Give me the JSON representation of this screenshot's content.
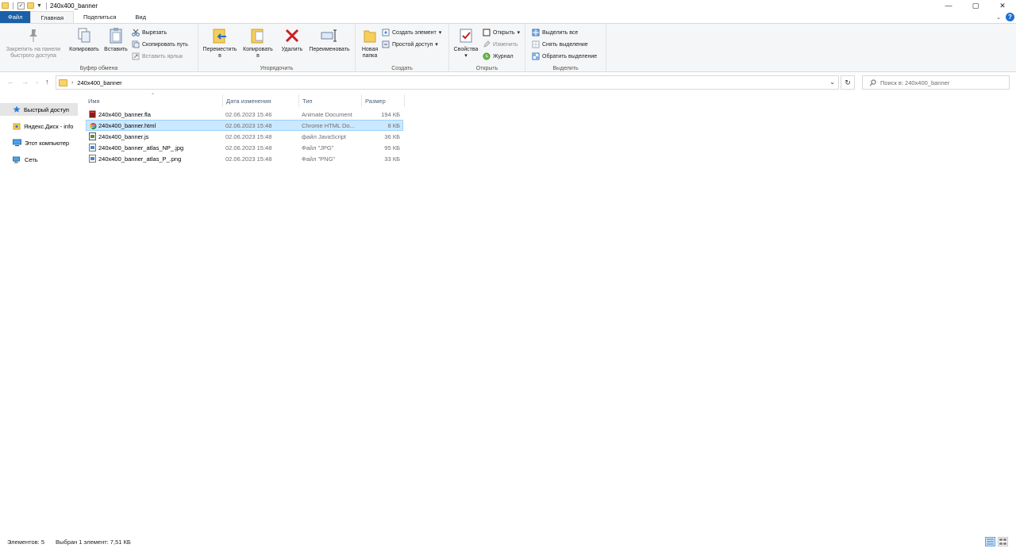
{
  "window": {
    "title": "240x400_banner",
    "controls": {
      "minimize": "—",
      "maximize": "▢",
      "close": "✕"
    }
  },
  "ribbon_tabs": [
    {
      "label": "Файл"
    },
    {
      "label": "Главная"
    },
    {
      "label": "Поделиться"
    },
    {
      "label": "Вид"
    }
  ],
  "ribbon": {
    "clipboard": {
      "label": "Буфер обмена",
      "pin_line1": "Закрепить на панели",
      "pin_line2": "быстрого доступа",
      "copy": "Копировать",
      "paste": "Вставить",
      "cut": "Вырезать",
      "copy_path": "Скопировать путь",
      "paste_shortcut": "Вставить ярлык"
    },
    "organize": {
      "label": "Упорядочить",
      "move_line1": "Переместить",
      "move_line2": "в",
      "copy_line1": "Копировать",
      "copy_line2": "в",
      "delete": "Удалить",
      "rename": "Переименовать"
    },
    "create": {
      "label": "Создать",
      "new_folder_line1": "Новая",
      "new_folder_line2": "папка",
      "new_item": "Создать элемент",
      "easy_access": "Простой доступ"
    },
    "open": {
      "label": "Открыть",
      "properties": "Свойства",
      "open": "Открыть",
      "edit": "Изменить",
      "history": "Журнал"
    },
    "select": {
      "label": "Выделить",
      "select_all": "Выделить все",
      "select_none": "Снять выделение",
      "invert": "Обратить выделение"
    }
  },
  "address": {
    "path": "240x400_banner",
    "search_placeholder": "Поиск в: 240x400_banner"
  },
  "nav_pane": [
    {
      "label": "Быстрый доступ",
      "icon": "star-icon",
      "selected": true
    },
    {
      "label": "Яндекс.Диск - info",
      "icon": "yandex-disk-icon",
      "selected": false
    },
    {
      "label": "Этот компьютер",
      "icon": "computer-icon",
      "selected": false
    },
    {
      "label": "Сеть",
      "icon": "network-icon",
      "selected": false
    }
  ],
  "columns": {
    "name": "Имя",
    "date": "Дата изменения",
    "type": "Тип",
    "size": "Размер"
  },
  "files": [
    {
      "name": "240x400_banner.fla",
      "date": "02.06.2023 15:46",
      "type": "Animate Document",
      "size": "194 КБ",
      "icon": "fla-icon",
      "color": "#8b1b1b"
    },
    {
      "name": "240x400_banner.html",
      "date": "02.06.2023 15:48",
      "type": "Chrome HTML Do...",
      "size": "8 КБ",
      "icon": "chrome-icon",
      "color": "#db4437"
    },
    {
      "name": "240x400_banner.js",
      "date": "02.06.2023 15:48",
      "type": "файл JavaScript",
      "size": "36 КБ",
      "icon": "js-file-icon",
      "color": "#5a8a3a"
    },
    {
      "name": "240x400_banner_atlas_NP_.jpg",
      "date": "02.06.2023 15:48",
      "type": "Файл \"JPG\"",
      "size": "95 КБ",
      "icon": "image-file-icon",
      "color": "#4a86c8"
    },
    {
      "name": "240x400_banner_atlas_P_.png",
      "date": "02.06.2023 15:48",
      "type": "Файл \"PNG\"",
      "size": "33 КБ",
      "icon": "image-file-icon",
      "color": "#4a86c8"
    }
  ],
  "selected_index": 1,
  "status": {
    "count": "Элементов: 5",
    "selection": "Выбран 1 элемент: 7,51 КБ"
  }
}
